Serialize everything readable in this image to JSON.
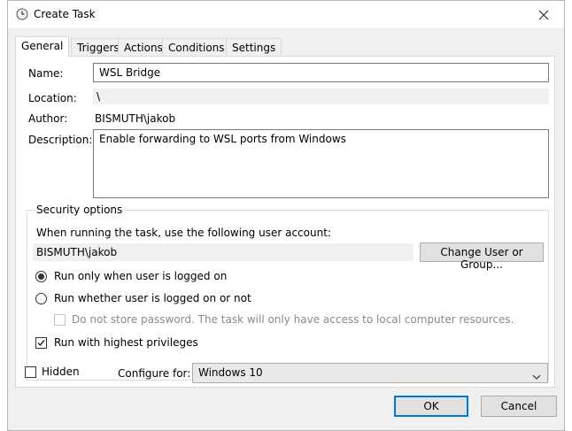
{
  "window": {
    "title": "Create Task"
  },
  "tabs": [
    {
      "label": "General"
    },
    {
      "label": "Triggers"
    },
    {
      "label": "Actions"
    },
    {
      "label": "Conditions"
    },
    {
      "label": "Settings"
    }
  ],
  "general": {
    "name_label": "Name:",
    "name_value": "WSL Bridge",
    "location_label": "Location:",
    "location_value": "\\",
    "author_label": "Author:",
    "author_value": "BISMUTH\\jakob",
    "description_label": "Description:",
    "description_value": "Enable forwarding to WSL ports from Windows"
  },
  "security": {
    "title": "Security options",
    "account_prompt": "When running the task, use the following user account:",
    "account_value": "BISMUTH\\jakob",
    "change_button": "Change User or Group...",
    "radio_logged_on": "Run only when user is logged on",
    "radio_whether": "Run whether user is logged on or not",
    "no_store_password": "Do not store password.  The task will only have access to local computer resources.",
    "highest_privileges": "Run with highest privileges"
  },
  "bottom": {
    "hidden_label": "Hidden",
    "configure_label": "Configure for:",
    "configure_value": "Windows 10"
  },
  "buttons": {
    "ok": "OK",
    "cancel": "Cancel"
  },
  "state": {
    "active_tab": "General",
    "run_only_logged_on": true,
    "run_whether": false,
    "no_store_password_checked": false,
    "no_store_password_enabled": false,
    "highest_privileges_checked": true,
    "hidden_checked": false
  },
  "colors": {
    "accent": "#0078d7",
    "dialog_bg": "#f0f0f0",
    "panel_bg": "#ffffff"
  }
}
